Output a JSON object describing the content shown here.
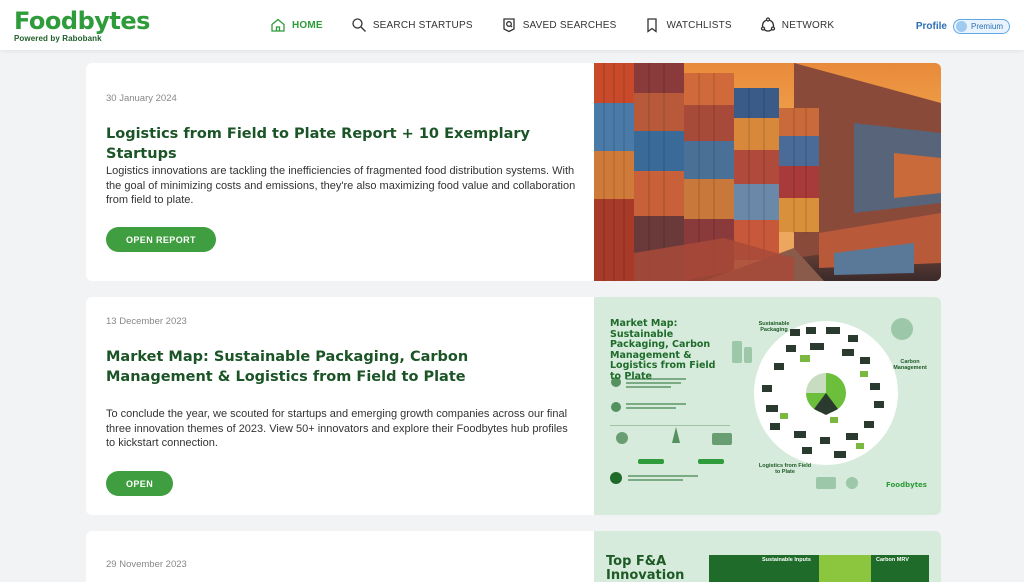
{
  "header": {
    "logo": "Foodbytes",
    "logo_sub": "Powered by Rabobank",
    "nav": [
      {
        "label": "HOME",
        "icon": "home-icon",
        "active": true
      },
      {
        "label": "SEARCH STARTUPS",
        "icon": "search-icon",
        "active": false
      },
      {
        "label": "SAVED SEARCHES",
        "icon": "saved-search-icon",
        "active": false
      },
      {
        "label": "WATCHLISTS",
        "icon": "bookmark-icon",
        "active": false
      },
      {
        "label": "NETWORK",
        "icon": "network-icon",
        "active": false
      }
    ],
    "profile_label": "Profile",
    "premium_label": "Premium"
  },
  "cards": [
    {
      "date": "30 January 2024",
      "title": "Logistics from Field to Plate Report + 10 Exemplary Startups",
      "description": "Logistics innovations are tackling the inefficiencies of fragmented food distribution systems. With the goal of minimizing costs and emissions, they're also maximizing food value and collaboration from field to plate.",
      "button": "OPEN REPORT"
    },
    {
      "date": "13 December 2023",
      "title": "Market Map: Sustainable Packaging, Carbon Management & Logistics from Field to Plate",
      "description": "To conclude the year, we scouted for startups and emerging growth companies across our final three innovation themes of 2023. View 50+ innovators and explore their Foodbytes hub profiles to kickstart connection.",
      "button": "OPEN",
      "thumb": {
        "title": "Market Map: Sustainable Packaging, Carbon Management & Logistics from Field to Plate",
        "label_packaging": "Sustainable Packaging",
        "label_carbon": "Carbon Management",
        "label_logistics": "Logistics from Field to Plate",
        "brand": "Foodbytes"
      }
    },
    {
      "date": "29 November 2023",
      "thumb": {
        "title": "Top F&A Innovation",
        "label_inputs": "Sustainable Inputs",
        "label_carbon": "Carbon MRV"
      }
    }
  ],
  "colors": {
    "brand_green": "#2e9c3a",
    "title_green": "#1b5426",
    "button_green": "#3f9e3f",
    "profile_blue": "#2a6fb5"
  }
}
